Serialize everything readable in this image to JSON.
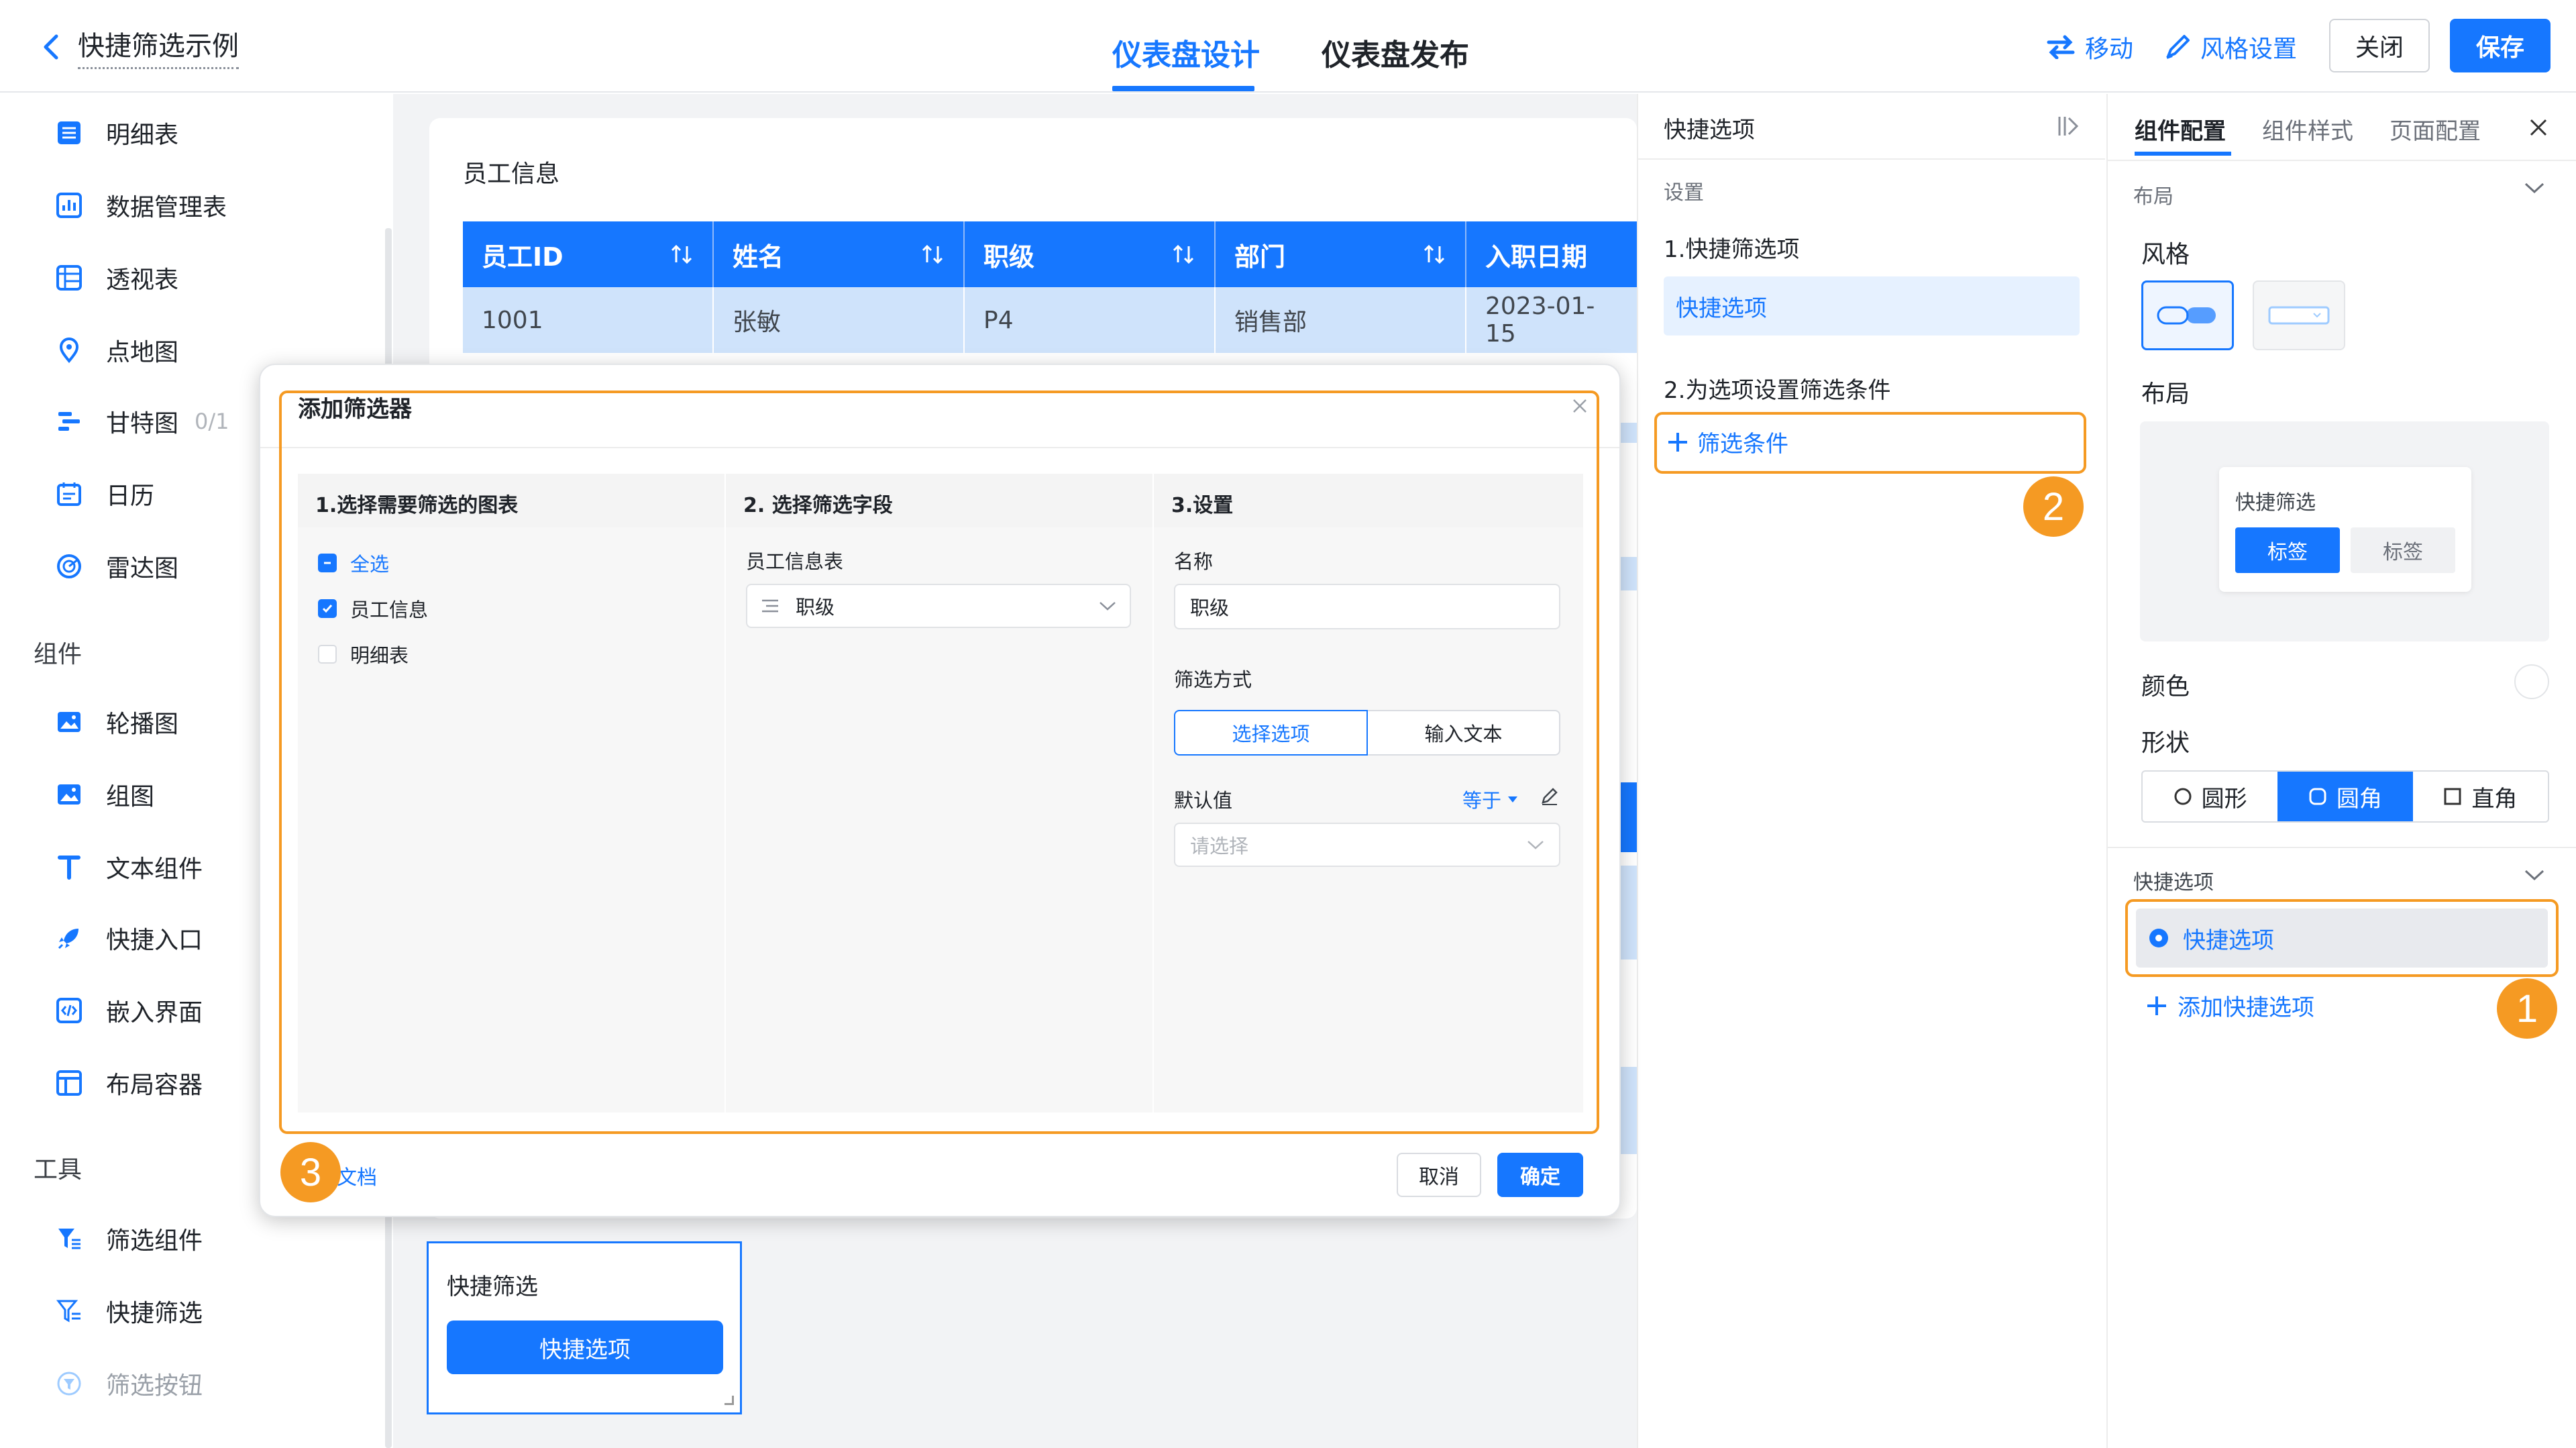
{
  "header": {
    "app_title": "快捷筛选示例",
    "tabs": [
      {
        "label": "仪表盘设计",
        "active": true
      },
      {
        "label": "仪表盘发布",
        "active": false
      }
    ],
    "move_label": "移动",
    "style_label": "风格设置",
    "close_label": "关闭",
    "save_label": "保存"
  },
  "sidebar": {
    "items_top": [
      {
        "label": "明细表",
        "icon": "table-icon"
      },
      {
        "label": "数据管理表",
        "icon": "data-table-icon"
      },
      {
        "label": "透视表",
        "icon": "pivot-icon"
      },
      {
        "label": "点地图",
        "icon": "map-pin-icon"
      },
      {
        "label": "甘特图",
        "icon": "gantt-icon",
        "count": "0/1"
      },
      {
        "label": "日历",
        "icon": "calendar-icon"
      },
      {
        "label": "雷达图",
        "icon": "radar-icon"
      }
    ],
    "section_components": "组件",
    "items_components": [
      {
        "label": "轮播图",
        "icon": "carousel-icon"
      },
      {
        "label": "组图",
        "icon": "image-group-icon"
      },
      {
        "label": "文本组件",
        "icon": "text-icon"
      },
      {
        "label": "快捷入口",
        "icon": "rocket-icon"
      },
      {
        "label": "嵌入界面",
        "icon": "embed-icon"
      },
      {
        "label": "布局容器",
        "icon": "layout-icon"
      }
    ],
    "section_tools": "工具",
    "items_tools": [
      {
        "label": "筛选组件",
        "icon": "filter-icon"
      },
      {
        "label": "快捷筛选",
        "icon": "quick-filter-icon"
      },
      {
        "label": "筛选按钮",
        "icon": "filter-button-icon",
        "disabled": true
      }
    ]
  },
  "canvas": {
    "table_title": "员工信息",
    "columns": [
      "员工ID",
      "姓名",
      "职级",
      "部门",
      "入职日期"
    ],
    "row": [
      "1001",
      "张敏",
      "P4",
      "销售部",
      "2023-01-15"
    ],
    "quick_filter_title": "快捷筛选",
    "quick_filter_button": "快捷选项"
  },
  "mid_panel": {
    "title": "快捷选项",
    "settings_label": "设置",
    "step1": "1.快捷筛选项",
    "selected_item": "快捷选项",
    "step2": "2.为选项设置筛选条件",
    "add_condition": "筛选条件",
    "badge": "2"
  },
  "right_panel": {
    "tabs": [
      "组件配置",
      "组件样式",
      "页面配置"
    ],
    "layout_section": "布局",
    "style_label": "风格",
    "layout_label": "布局",
    "preview_title": "快捷筛选",
    "preview_tag_active": "标签",
    "preview_tag": "标签",
    "color_label": "颜色",
    "shape_label": "形状",
    "shapes": [
      {
        "label": "圆形",
        "active": false
      },
      {
        "label": "圆角",
        "active": true
      },
      {
        "label": "直角",
        "active": false
      }
    ],
    "quick_section": "快捷选项",
    "quick_item": "快捷选项",
    "add_quick": "添加快捷选项",
    "badge": "1"
  },
  "modal": {
    "title": "添加筛选器",
    "col1_head": "1.选择需要筛选的图表",
    "select_all": "全选",
    "chart1": "员工信息",
    "chart2": "明细表",
    "col2_head": "2. 选择筛选字段",
    "table_name": "员工信息表",
    "field_value": "职级",
    "col3_head": "3.设置",
    "name_label": "名称",
    "name_value": "职级",
    "mode_label": "筛选方式",
    "mode_select": "选择选项",
    "mode_text": "输入文本",
    "default_label": "默认值",
    "equals": "等于",
    "default_placeholder": "请选择",
    "doc_link": "文档",
    "cancel": "取消",
    "confirm": "确定",
    "badge": "3"
  },
  "colors": {
    "primary": "#1677ff",
    "highlight": "#f59a23",
    "row_bg": "#cfe3fb"
  }
}
